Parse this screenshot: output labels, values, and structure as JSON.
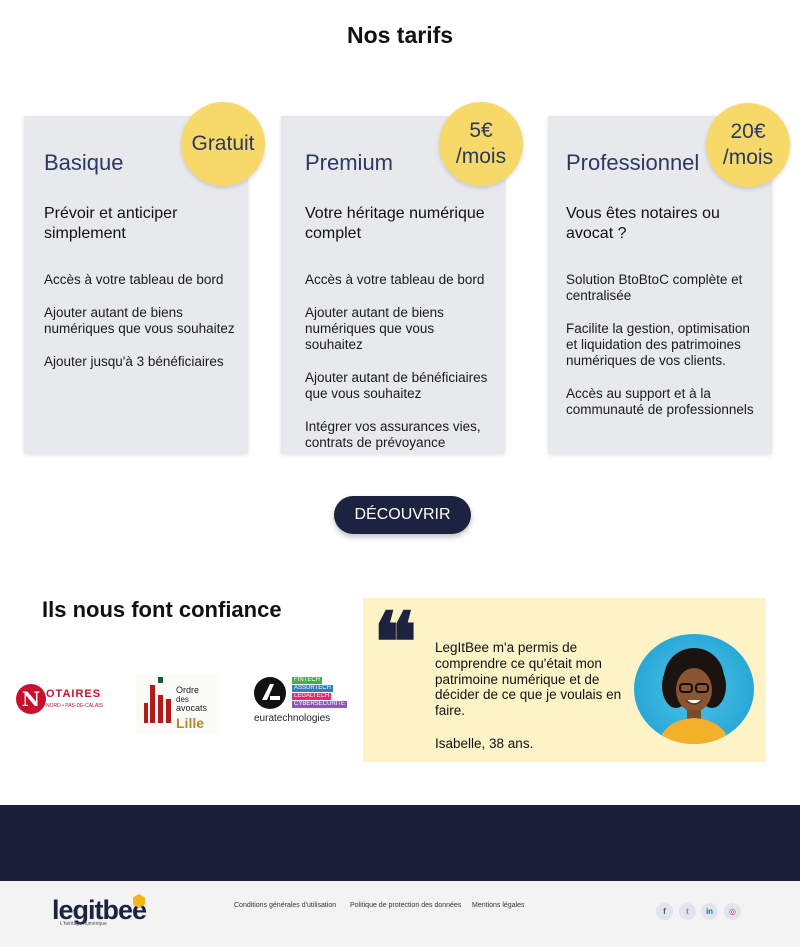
{
  "section": {
    "title": "Nos tarifs"
  },
  "plans": [
    {
      "name": "Basique",
      "price_line1": "Gratuit",
      "price_line2": "",
      "subtitle": "Prévoir et anticiper simplement",
      "features": [
        "Accès à votre tableau de bord",
        "Ajouter autant de biens numériques que vous souhaitez",
        "Ajouter jusqu'à 3 bénéficiaires"
      ]
    },
    {
      "name": "Premium",
      "price_line1": "5€",
      "price_line2": "/mois",
      "subtitle": "Votre héritage numérique complet",
      "features": [
        "Accès à votre tableau de bord",
        "Ajouter autant de biens numériques que vous souhaitez",
        "Ajouter autant de bénéficiaires que vous souhaitez",
        "Intégrer vos assurances vies, contrats de prévoyance"
      ]
    },
    {
      "name": "Professionnel",
      "price_line1": "20€",
      "price_line2": "/mois",
      "subtitle": "Vous êtes notaires ou avocat ?",
      "features": [
        "Solution BtoBtoC complète et centralisée",
        "Facilite la gestion, optimisation et liquidation des patrimoines numériques de vos clients.",
        "Accès au support et à la communauté de professionnels"
      ]
    }
  ],
  "cta": {
    "label": "DÉCOUVRIR"
  },
  "trust": {
    "title": "Ils nous font confiance",
    "logos": {
      "notaires": {
        "big": "OTAIRES",
        "small": "NORD • PAS-DE-CALAIS"
      },
      "avocats": {
        "line1": "Ordre",
        "line2": "des",
        "line3": "avocats",
        "city": "Lille"
      },
      "eura": {
        "tags": [
          "FINTECH",
          "ASSURTECH",
          "LEGALTECH",
          "CYBERSÉCURITÉ"
        ],
        "name": "euratechnologies"
      }
    }
  },
  "testimonial": {
    "quote": "LegItBee m'a permis de comprendre ce qu'était mon patrimoine numérique et de décider de ce que je voulais en faire.",
    "author": "Isabelle, 38 ans."
  },
  "footer": {
    "brand": "legitbee",
    "tagline": "L'héritage numérique",
    "links": [
      "Conditions générales d'utilisation",
      "Politique de protection des données",
      "Mentions légales"
    ],
    "social": [
      {
        "icon": "facebook-icon",
        "glyph": "f",
        "color": "#3b5998"
      },
      {
        "icon": "twitter-icon",
        "glyph": "t",
        "color": "#1da1f2"
      },
      {
        "icon": "linkedin-icon",
        "glyph": "in",
        "color": "#0077b5"
      },
      {
        "icon": "instagram-icon",
        "glyph": "◎",
        "color": "#c13584"
      }
    ]
  },
  "colors": {
    "navy": "#1c2340",
    "title_blue": "#2b3860",
    "badge": "#f7d96a",
    "card": "#e8e9ed",
    "testimonial_bg": "#fdf3c6"
  }
}
